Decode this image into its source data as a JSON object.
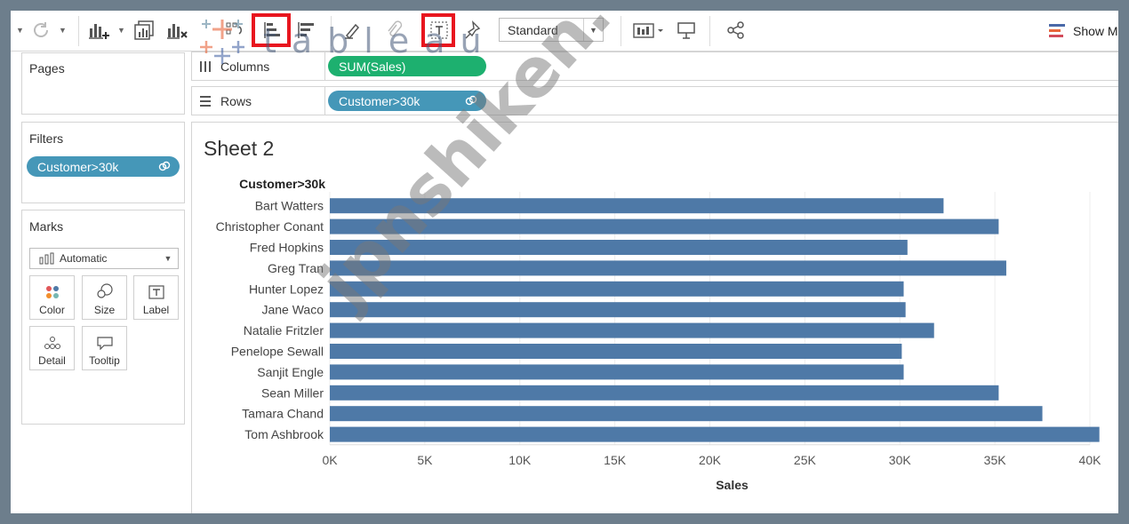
{
  "app": {
    "logo_text": "tableau"
  },
  "toolbar": {
    "mark_size_option": "Standard",
    "show_me_label": "Show M",
    "show_me_colors": [
      "#e8663b",
      "#4a69a8",
      "#d24b5a"
    ],
    "icons": [
      "undo-caret",
      "refresh-icon",
      "new-worksheet-icon",
      "duplicate-icon",
      "clear-sheet-icon",
      "swap-axes-icon",
      "sort-ascending-icon",
      "sort-descending-icon",
      "highlight-icon",
      "group-icon",
      "show-mark-labels-icon",
      "pin-icon",
      "fit-icon",
      "presentation-icon",
      "share-icon"
    ]
  },
  "cards": {
    "pages": {
      "title": "Pages"
    },
    "filters": {
      "title": "Filters",
      "items": [
        {
          "label": "Customer>30k"
        }
      ]
    },
    "marks": {
      "title": "Marks",
      "mark_type": "Automatic",
      "buttons": [
        {
          "label": "Color",
          "icon": "color-icon"
        },
        {
          "label": "Size",
          "icon": "size-icon"
        },
        {
          "label": "Label",
          "icon": "label-icon"
        },
        {
          "label": "Detail",
          "icon": "detail-icon"
        },
        {
          "label": "Tooltip",
          "icon": "tooltip-icon"
        }
      ]
    }
  },
  "shelves": {
    "columns": {
      "label": "Columns",
      "pill": "SUM(Sales)"
    },
    "rows": {
      "label": "Rows",
      "pill": "Customer>30k"
    }
  },
  "view": {
    "sheet_title": "Sheet 2",
    "row_header": "Customer>30k"
  },
  "watermark": "jpnshiken.com",
  "colors": {
    "bar": "#4e79a7",
    "pill_blue": "#4597b8",
    "pill_green": "#1db06f",
    "highlight": "#e8161f"
  },
  "chart_data": {
    "type": "bar",
    "orientation": "horizontal",
    "categories": [
      "Bart Watters",
      "Christopher Conant",
      "Fred Hopkins",
      "Greg Tran",
      "Hunter Lopez",
      "Jane Waco",
      "Natalie Fritzler",
      "Penelope Sewall",
      "Sanjit Engle",
      "Sean Miller",
      "Tamara Chand",
      "Tom Ashbrook"
    ],
    "values": [
      32300,
      35200,
      30400,
      35600,
      30200,
      30300,
      31800,
      30100,
      30200,
      35200,
      37500,
      40500
    ],
    "xlabel": "Sales",
    "ylabel": "Customer>30k",
    "xlim": [
      0,
      40000
    ],
    "x_ticks": [
      "0K",
      "5K",
      "10K",
      "15K",
      "20K",
      "25K",
      "30K",
      "35K",
      "40K"
    ],
    "grid": true
  }
}
